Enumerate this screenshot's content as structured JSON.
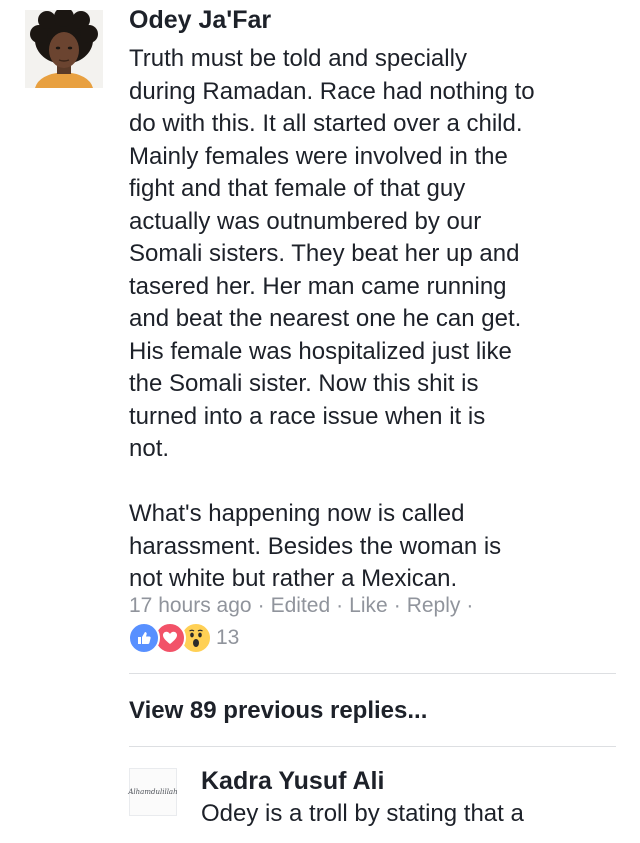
{
  "comment": {
    "avatar_icon": "profile-photo",
    "author": "Odey Ja'Far",
    "paragraph_1": [
      "Truth must be told and specially",
      "during Ramadan. Race had nothing to",
      "do with this. It all started over a child.",
      "Mainly females were involved in the",
      "fight and that female of that guy",
      "actually was outnumbered by our",
      "Somali sisters. They beat her up and",
      "tasered her. Her man came running",
      "and beat the nearest one he can get.",
      "His female was hospitalized just like",
      "the Somali sister. Now this shit is",
      "turned into a race issue when it is",
      "not."
    ],
    "paragraph_2": [
      "What's happening now is called",
      "harassment. Besides the woman is",
      "not white but rather a Mexican."
    ],
    "meta": {
      "timestamp": "17 hours ago",
      "edited": "Edited",
      "like": "Like",
      "reply": "Reply",
      "separator": "·"
    },
    "reactions": {
      "icons": [
        "like-icon",
        "love-icon",
        "wow-icon"
      ],
      "count": "13",
      "colors": {
        "like": "#5890ff",
        "love": "#f25268",
        "wow": "#ffd055"
      }
    }
  },
  "view_previous": "View 89 previous replies...",
  "reply": {
    "avatar_text": "Alhamdulillah",
    "author": "Kadra Yusuf Ali",
    "text": "Odey is a troll by stating that a"
  },
  "colors": {
    "text": "#1d2129",
    "meta": "#90949c",
    "divider": "#dddfe2"
  }
}
